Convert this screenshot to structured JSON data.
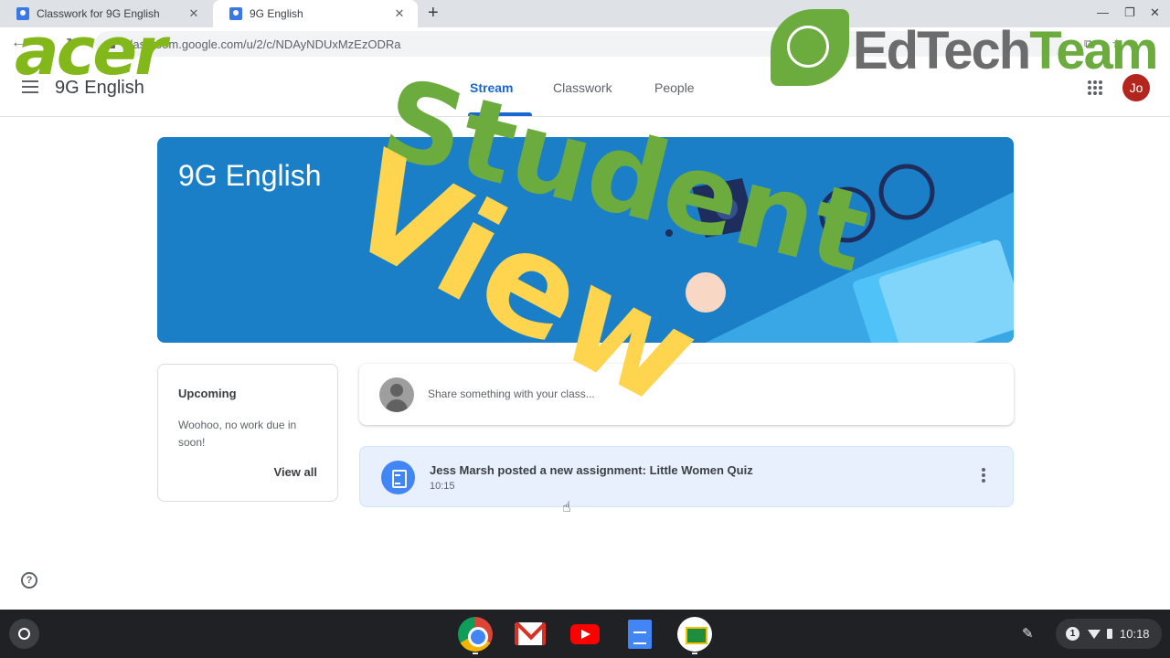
{
  "browser": {
    "tabs": [
      {
        "title": "Classwork for 9G English",
        "active": false
      },
      {
        "title": "9G English",
        "active": true
      }
    ],
    "new_tab": "+",
    "url": "classroom.google.com/u/2/c/NDAyNDUxMzEzODRa"
  },
  "header": {
    "class_title": "9G English",
    "tabs": [
      "Stream",
      "Classwork",
      "People"
    ],
    "active_tab": "Stream",
    "avatar_initials": "Jo",
    "avatar_color": "#b3261e"
  },
  "banner": {
    "title": "9G English",
    "color": "#1a7fc7"
  },
  "upcoming": {
    "heading": "Upcoming",
    "message": "Woohoo, no work due in soon!",
    "view_all": "View all"
  },
  "share": {
    "placeholder": "Share something with your class..."
  },
  "post": {
    "title": "Jess Marsh posted a new assignment: Little Women Quiz",
    "time": "10:15",
    "icon": "assignment-icon"
  },
  "shelf": {
    "apps": [
      "chrome",
      "gmail",
      "youtube",
      "docs",
      "classroom"
    ],
    "notification_count": "1",
    "clock": "10:18"
  },
  "overlay": {
    "acer_logo": "acer",
    "edtech_logo_dark": "EdTech",
    "edtech_logo_green": "Team",
    "headline_1": "Student",
    "headline_2": "View"
  },
  "colors": {
    "accent": "#1967d2",
    "edtech_green": "#6cab3d",
    "acer_green": "#83b81a",
    "view_yellow": "#ffd54f"
  }
}
